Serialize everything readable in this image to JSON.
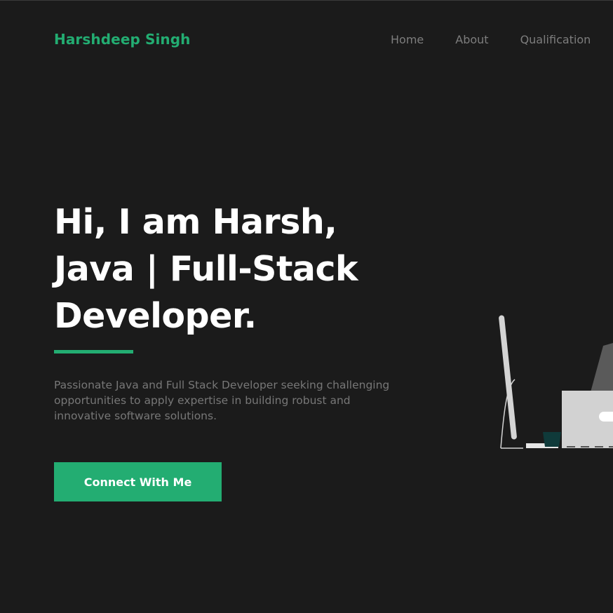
{
  "header": {
    "brand": "Harshdeep Singh",
    "nav": [
      "Home",
      "About",
      "Qualification"
    ]
  },
  "hero": {
    "headline_lines": [
      "Hi, I am Harsh,",
      "Java | Full-Stack",
      "Developer."
    ],
    "description": "Passionate Java and Full Stack Developer seeking challenging opportunities to apply expertise in building robust and innovative software solutions.",
    "cta_label": "Connect With Me"
  },
  "illustration": {
    "icon": "developer-at-desk-illustration"
  },
  "colors": {
    "background": "#1b1b1b",
    "accent": "#23ad72",
    "heading": "#ffffff",
    "muted": "#777777",
    "nav": "#7d7d7d"
  }
}
